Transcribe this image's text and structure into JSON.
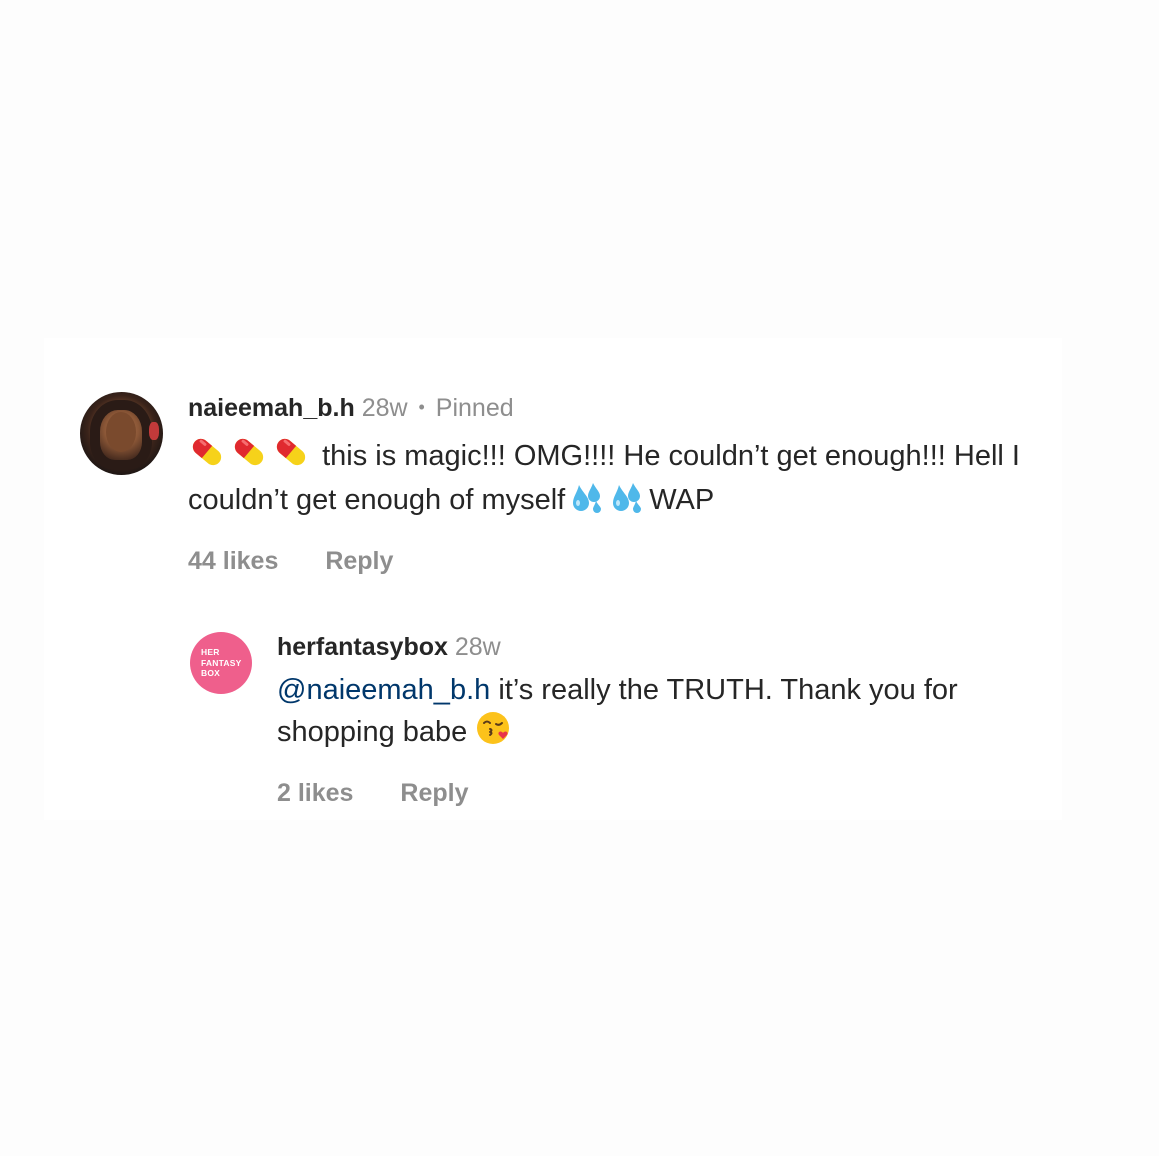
{
  "comments": [
    {
      "username": "naieemah_b.h",
      "time": "28w",
      "separator": "•",
      "pinned": "Pinned",
      "avatar_icon": "user-avatar",
      "text_part1": "this is magic!!! OMG!!!! He couldn’t get enough!!! Hell I couldn’t get enough of myself",
      "text_part2": "WAP",
      "leading_emojis": [
        "pill-icon",
        "pill-icon",
        "pill-icon"
      ],
      "trailing_emojis": [
        "sweat-droplets-icon",
        "sweat-droplets-icon"
      ],
      "likes": "44 likes",
      "reply_label": "Reply"
    },
    {
      "username": "herfantasybox",
      "time": "28w",
      "avatar_icon": "brand-logo",
      "logo_text": "HER\nFANTASY\nBOX",
      "mention": "@naieemah_b.h",
      "text": " it’s really the TRUTH. Thank you for shopping babe ",
      "trailing_emojis": [
        "face-blowing-kiss-icon"
      ],
      "likes": "2 likes",
      "reply_label": "Reply"
    }
  ],
  "colors": {
    "username": "#262626",
    "meta": "#8e8e8e",
    "mention": "#00376b",
    "brand_pink": "#ef5f8c"
  }
}
